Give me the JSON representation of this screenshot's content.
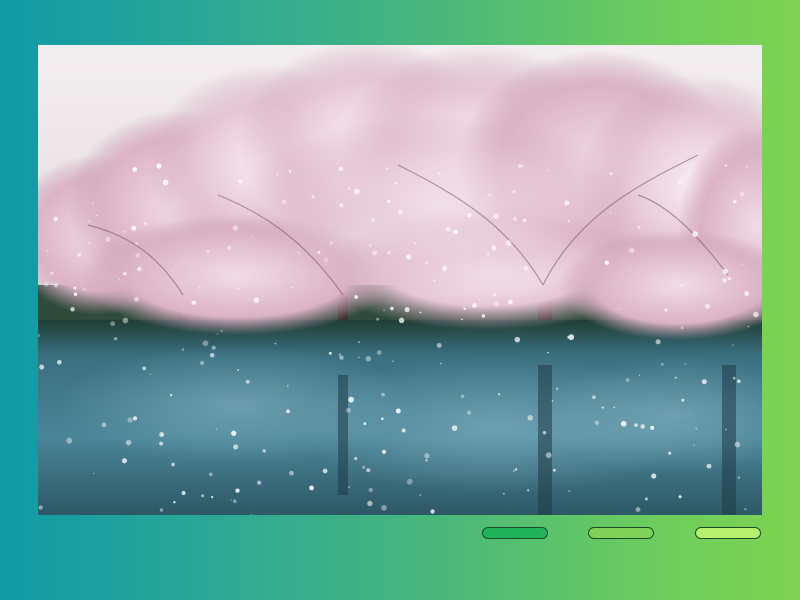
{
  "photo": {
    "subject": "cherry-blossom-trees-snow-pond",
    "sky_color": "#ece7ea",
    "blossom_color": "#e6c4d3",
    "water_color": "#3f7486"
  },
  "pagination": {
    "dots": [
      {
        "color": "#1fb35a",
        "active": true
      },
      {
        "color": "#7fd158",
        "active": false
      },
      {
        "color": "#b7ef6f",
        "active": false
      }
    ]
  }
}
